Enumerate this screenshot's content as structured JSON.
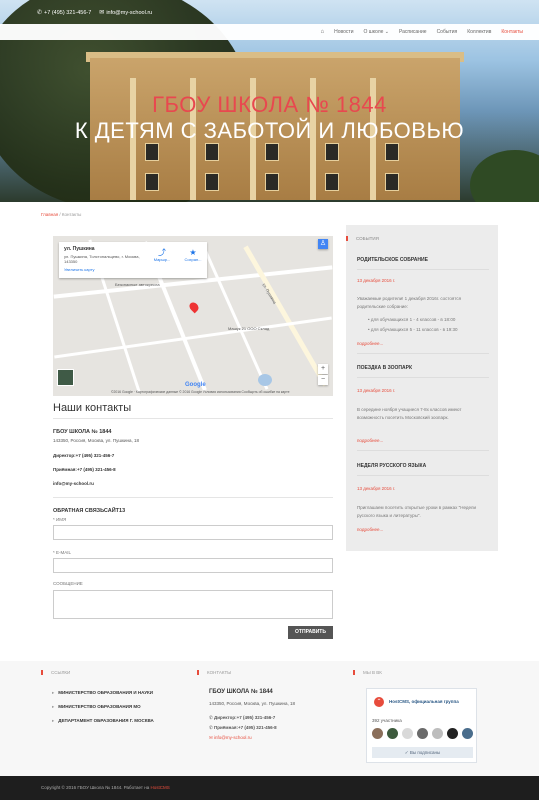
{
  "topbar": {
    "phone": "+7 (495) 321-456-7",
    "email": "info@my-school.ru"
  },
  "nav": {
    "items": [
      "Новости",
      "О школе",
      "Расписание",
      "События",
      "Коллектив",
      "Контакты"
    ],
    "active": "Контакты"
  },
  "hero": {
    "title": "ГБОУ ШКОЛА № 1844",
    "subtitle": "К ДЕТЯМ С ЗАБОТОЙ И ЛЮБОВЬЮ"
  },
  "breadcrumbs": {
    "home": "Главная",
    "current": "Контакты"
  },
  "map": {
    "place": "ул. Пушкина",
    "address": "ул. Пушкина, Толстопальцево, г. Москва, 143350",
    "enlarge": "Увеличить карту",
    "route": "Маршр...",
    "save": "Сохран...",
    "label_1": "Безопасные автокресла",
    "label_2": "Машук 21 ООО Склад",
    "street_1": "ул. Пушкина",
    "footer": "©2016 Google · Картографические данные © 2016 Google   Условия использования   Сообщить об ошибке на карте",
    "google": "Google"
  },
  "contacts": {
    "heading": "Наши контакты",
    "org": "ГБОУ ШКОЛА № 1844",
    "address": "143350, Россия, Москва, ул. Пушкина, 18",
    "director_label": "Директор:",
    "director_phone": "+7 (495) 321-456-7",
    "reception_label": "Приёмная:",
    "reception_phone": "+7 (495) 321-456-8",
    "email": "info@my-school.ru"
  },
  "form": {
    "title": "ОБРАТНАЯ СВЯЗЬСАЙТ13",
    "name_label": "* ИМЯ",
    "email_label": "* E-MAIL",
    "message_label": "СООБЩЕНИЕ",
    "submit": "ОТПРАВИТЬ"
  },
  "events": {
    "heading": "СОБЫТИЯ",
    "items": [
      {
        "title": "РОДИТЕЛЬСКОЕ СОБРАНИЕ",
        "date": "13 декабря 2016 г.",
        "text": "Уважаемые родители! 1 декабря 2016г. состоятся родительские собрание:",
        "bullet_1": "для обучающихся 1 - 4 классов - в 18:00",
        "bullet_2": "для обучающихся 5 - 11 классов - в 19:30",
        "more": "подробнее..."
      },
      {
        "title": "ПОЕЗДКА В ЗООПАРК",
        "date": "13 декабря 2016 г.",
        "text": "В середине ноября учащиеся 7-8х классов имеют возможность посетить Московский зоопарк.",
        "more": "подробнее..."
      },
      {
        "title": "НЕДЕЛЯ РУССКОГО ЯЗЫКА",
        "date": "13 декабря 2016 г.",
        "text": "Приглашаем посетить открытые уроки в рамках \"Недели русского языка и литературы\".",
        "more": "подробнее..."
      }
    ]
  },
  "footer": {
    "links_heading": "ССЫЛКИ",
    "links": [
      "МИНИСТЕРСТВО ОБРАЗОВАНИЯ И НАУКИ",
      "МИНИСТЕРСТВО ОБРАЗОВАНИЯ МО",
      "ДЕПАРТАМЕНТ ОБРАЗОВАНИЯ Г. МОСКВА"
    ],
    "contacts_heading": "КОНТАКТЫ",
    "org": "ГБОУ ШКОЛА № 1844",
    "address": "143350, Россия, Москва, ул. Пушкина, 18",
    "director": "Директор:+7 (495) 321-456-7",
    "reception": "Приёмная:+7 (495) 321-456-8",
    "email": "info@my-school.ru",
    "vk_heading": "МЫ В ВК",
    "vk_group": "HostCMS, официальная группа",
    "vk_members": "392 участника",
    "vk_subscribed": "Вы подписаны"
  },
  "bottom": {
    "copyright": "Copyright © 2016 ГБОУ Школа № 1844. Работает на ",
    "cms": "HostCMS"
  },
  "colors": {
    "accent": "#e74c3c",
    "dark": "#1e1e1e",
    "sidebar": "#ececec"
  }
}
